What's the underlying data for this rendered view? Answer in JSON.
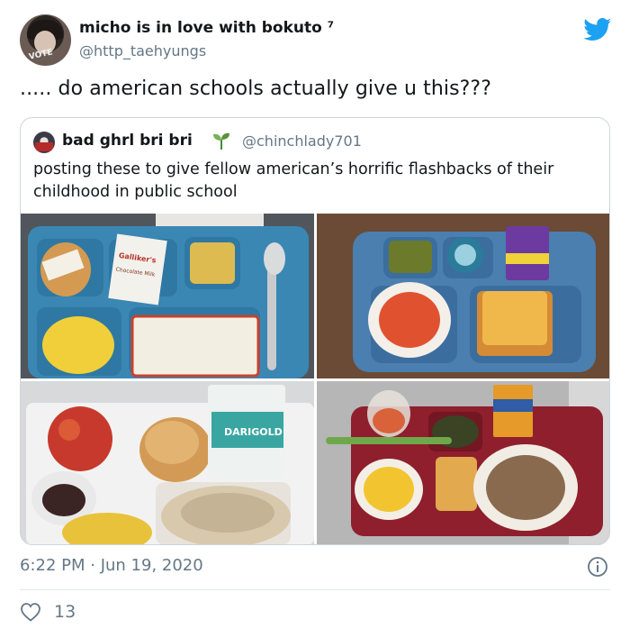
{
  "tweet": {
    "author": {
      "display_name": "micho is in love with bokuto ⁷",
      "handle": "@http_taehyungs"
    },
    "text": "..... do american schools actually give u this???",
    "timestamp": "6:22 PM · Jun 19, 2020",
    "likes": "13"
  },
  "quoted_tweet": {
    "author": {
      "display_name": "bad ghrl bri bri",
      "handle": "@chinchlady701"
    },
    "text": "posting these to give fellow american’s horrific flashbacks of their childhood in public school",
    "photos": [
      {
        "carton_brand": "Galliker's",
        "carton_label": "Chocolate Milk"
      },
      {
        "carton_brand": ""
      },
      {
        "carton_brand": "DARIGOLD"
      },
      {
        "carton_brand": ""
      }
    ]
  },
  "icons": {
    "brand": "twitter-bird-icon",
    "verified_emoji": "seedling-icon",
    "info": "info-icon",
    "like": "heart-icon"
  },
  "colors": {
    "twitter_blue": "#1da1f2",
    "secondary_text": "#657786",
    "border": "#ccd6dd"
  }
}
